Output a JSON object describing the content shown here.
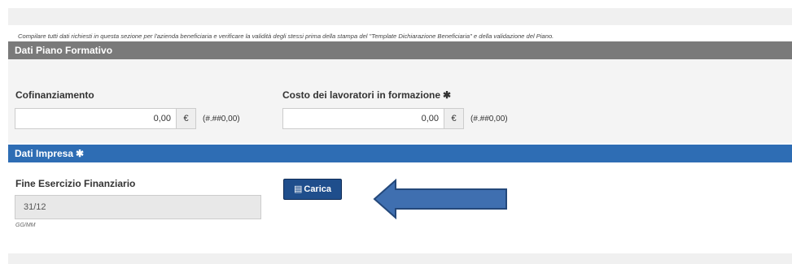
{
  "piano": {
    "header": "Dati Piano Formativo",
    "note": "Compilare tutti dati richiesti in questa sezione per l'azienda beneficiaria e verificare la validità degli stessi prima della stampa del \"Template Dichiarazione Beneficiaria\" e della validazione del Piano.",
    "cofinanziamento": {
      "label": "Cofinanziamento",
      "value": "0,00",
      "currency": "€",
      "format": "(#.##0,00)"
    },
    "costo": {
      "label": "Costo dei lavoratori in formazione",
      "required": "✱",
      "value": "0,00",
      "currency": "€",
      "format": "(#.##0,00)"
    }
  },
  "impresa": {
    "header": "Dati Impresa",
    "required": "✱",
    "fine_label": "Fine Esercizio Finanziario",
    "fine_value": "31/12",
    "fine_hint": "GG/MM",
    "carica_label": "Carica",
    "carica_icon": "list-icon"
  },
  "colors": {
    "gray_header": "#7a7a7a",
    "blue_header": "#2e6db4",
    "button": "#1f4e8c",
    "arrow": "#3f6fb0"
  }
}
